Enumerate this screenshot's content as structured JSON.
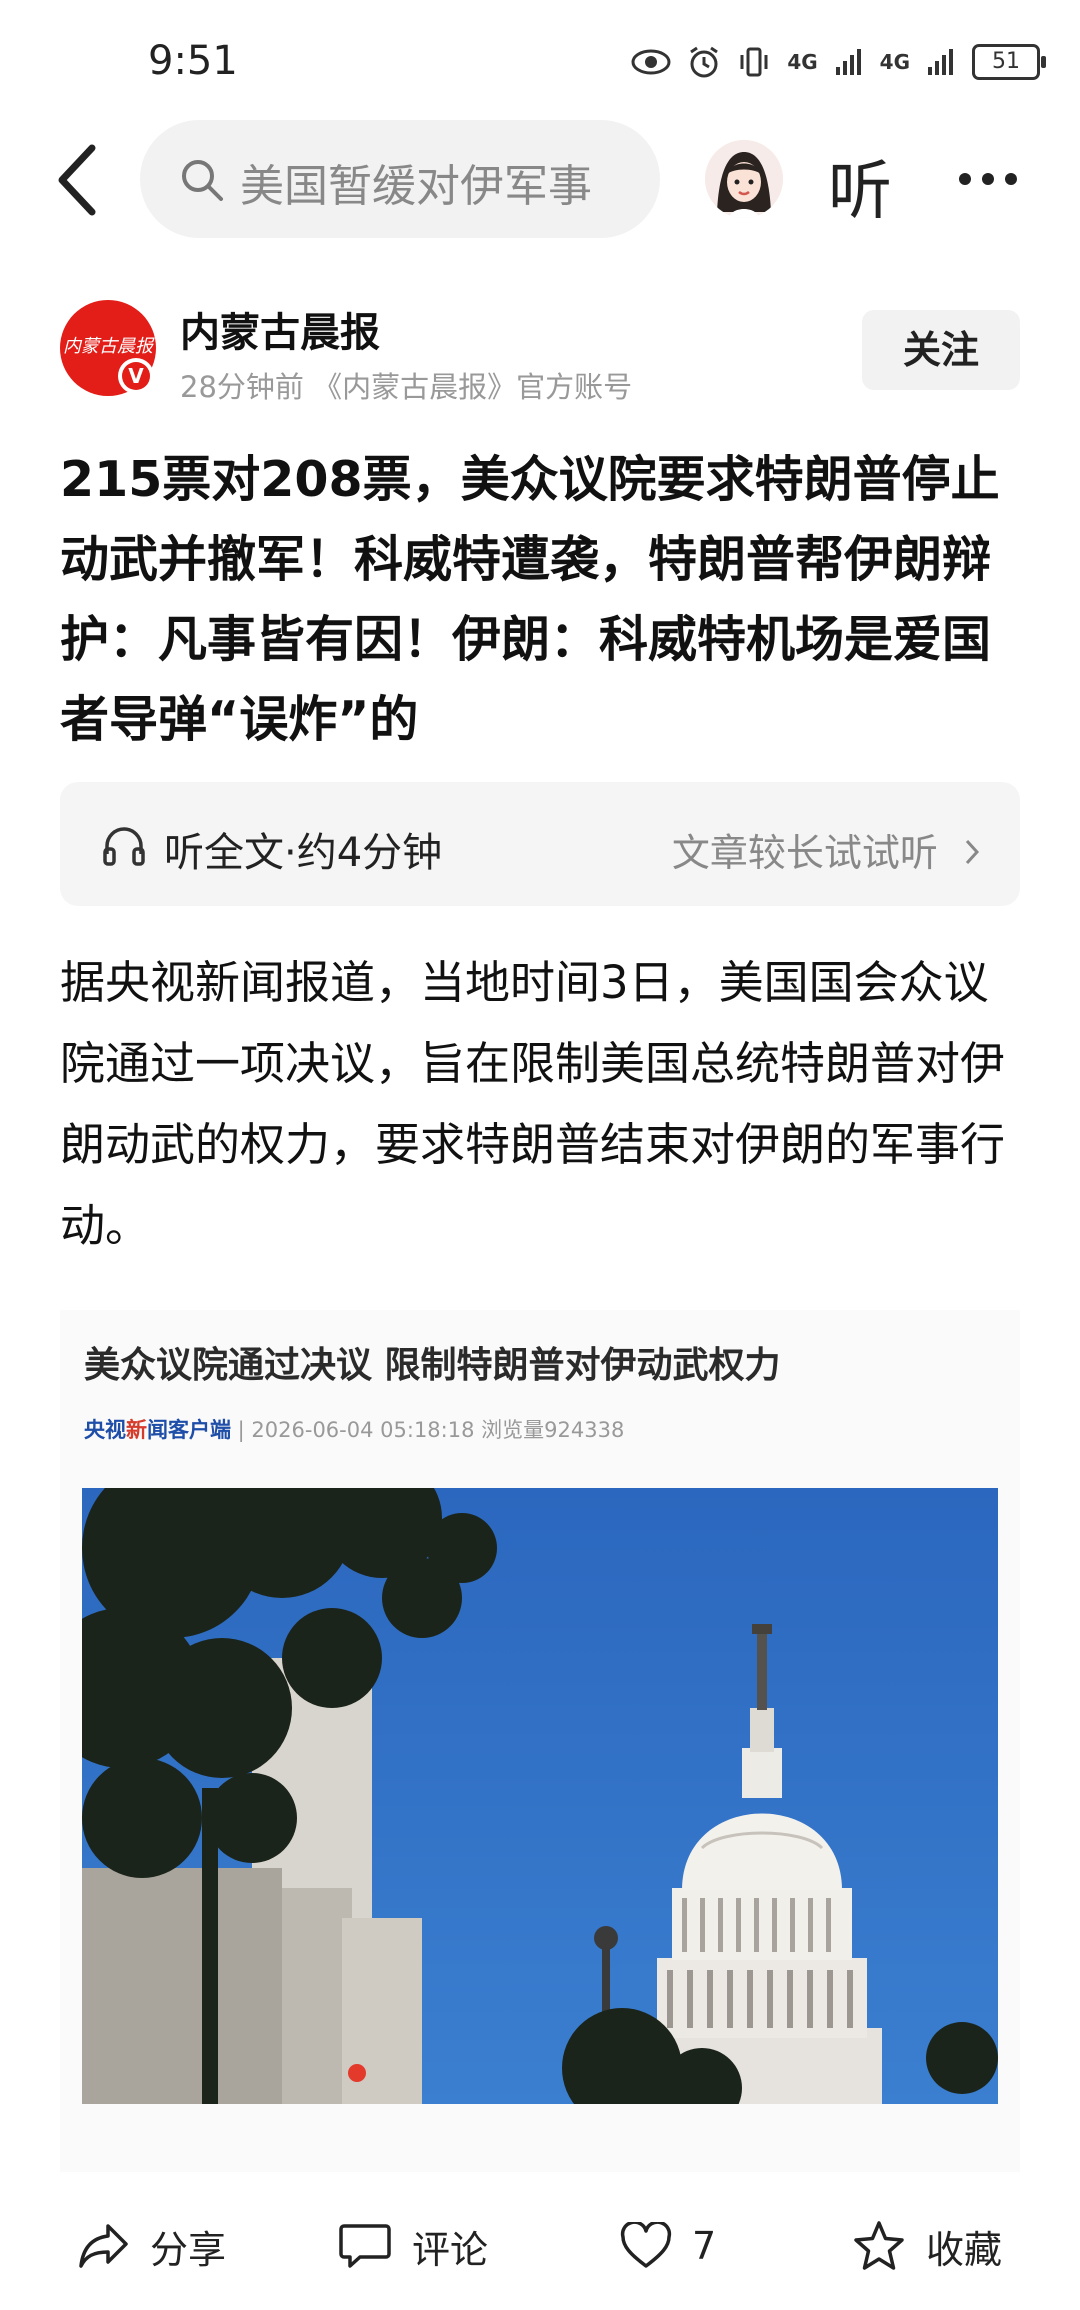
{
  "status_bar": {
    "time": "9:51",
    "network_1": "4G",
    "network_2": "4G",
    "battery": "51"
  },
  "top_nav": {
    "search_text": "美国暂缓对伊军事",
    "listen_label": "听"
  },
  "author": {
    "logo_text": "内蒙古晨报",
    "verified_mark": "V",
    "name": "内蒙古晨报",
    "meta": "28分钟前  《内蒙古晨报》官方账号",
    "follow_label": "关注"
  },
  "article": {
    "title": "215票对208票，美众议院要求特朗普停止动武并撤军！科威特遭袭，特朗普帮伊朗辩护：凡事皆有因！伊朗：科威特机场是爱国者导弹“误炸”的",
    "listen_full": "听全文·约4分钟",
    "listen_hint": "文章较长试试听",
    "body": "据央视新闻报道，当地时间3日，美国国会众议院通过一项决议，旨在限制美国总统特朗普对伊朗动武的权力，要求特朗普结束对伊朗的军事行动。"
  },
  "embed": {
    "title": "美众议院通过决议 限制特朗普对伊动武权力",
    "source_a": "央视",
    "source_b": "新",
    "source_c": "闻客户端",
    "source_meta": " | 2026-06-04 05:18:18  浏览量924338"
  },
  "bottom_bar": {
    "share": "分享",
    "comment": "评论",
    "like_count": "7",
    "collect": "收藏"
  },
  "colors": {
    "brand_red": "#e31d17",
    "sky_blue": "#2f6ec0",
    "pill_bg": "#f2f2f3"
  }
}
